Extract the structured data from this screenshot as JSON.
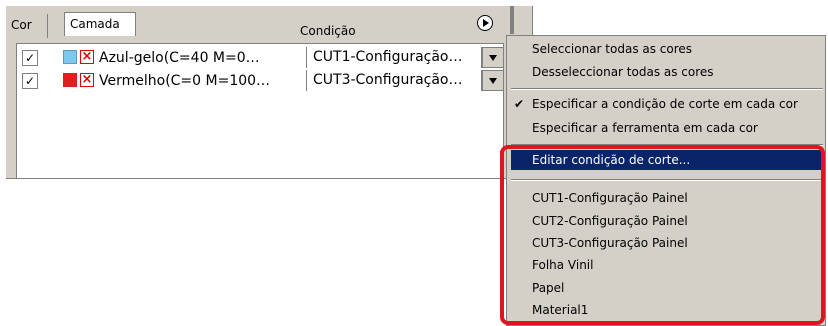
{
  "tabs": {
    "cor": "Cor",
    "camada": "Camada"
  },
  "header": {
    "condicao": "Condição"
  },
  "rows": [
    {
      "checked": "✓",
      "swatch_color": "#7ec8f0",
      "label": "Azul-gelo(C=40  M=0…",
      "condition": "CUT1-Configuração…"
    },
    {
      "checked": "✓",
      "swatch_color": "#e01e1e",
      "label": "Vermelho(C=0  M=100…",
      "condition": "CUT3-Configuração…"
    }
  ],
  "menu": {
    "select_all": "Seleccionar todas as cores",
    "deselect_all": "Desseleccionar todas as cores",
    "check_glyph": "✔",
    "specify_condition": "Especificar a condição de corte em cada cor",
    "specify_tool": "Especificar a ferramenta em cada cor",
    "edit_condition": "Editar condição de corte...",
    "presets": [
      "CUT1-Configuração Painel",
      "CUT2-Configuração Painel",
      "CUT3-Configuração Painel",
      "Folha Vinil",
      "Papel",
      "Material1"
    ]
  },
  "colors": {
    "highlight": "#0a246a",
    "annotation_border": "#e0161e"
  }
}
